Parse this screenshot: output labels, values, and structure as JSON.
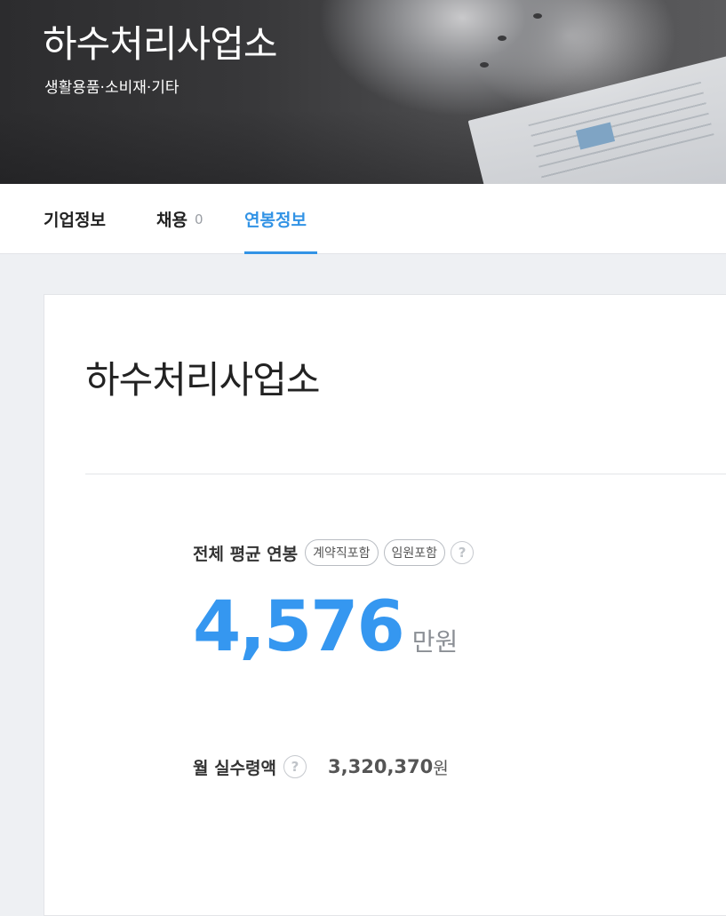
{
  "hero": {
    "title": "하수처리사업소",
    "subtitle": "생활용품·소비재·기타"
  },
  "tabs": [
    {
      "label": "기업정보",
      "active": false
    },
    {
      "label": "채용",
      "count": "0",
      "active": false
    },
    {
      "label": "연봉정보",
      "active": true
    }
  ],
  "card": {
    "company_name": "하수처리사업소",
    "average_salary": {
      "label": "전체 평균 연봉",
      "badges": [
        "계약직포함",
        "임원포함"
      ],
      "help_icon": "?",
      "value": "4,576",
      "unit": "만원"
    },
    "monthly_net": {
      "label": "월 실수령액",
      "help_icon": "?",
      "value": "3,320,370",
      "unit": "원"
    }
  },
  "colors": {
    "accent": "#3293e5",
    "salary_value": "#3597f0",
    "page_bg": "#eef0f3"
  }
}
